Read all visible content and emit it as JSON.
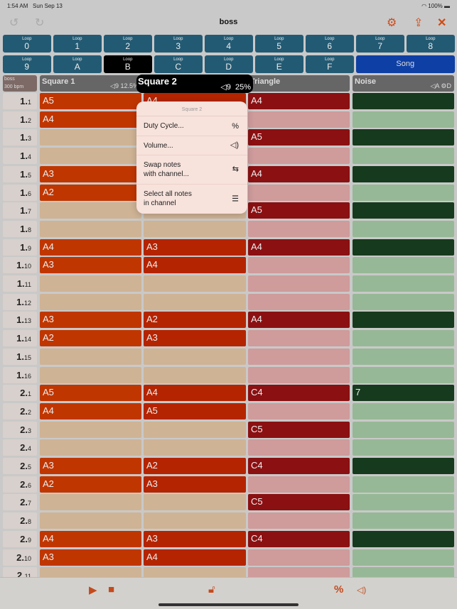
{
  "status": {
    "time": "1:54 AM",
    "date": "Sun Sep 13",
    "battery": "100%"
  },
  "header": {
    "title": "boss",
    "icons": [
      "undo-icon",
      "redo-icon",
      "settings-gear-icon",
      "share-icon",
      "close-icon"
    ],
    "accent": "#d04a14"
  },
  "loops": {
    "small": "Loop",
    "labels": [
      "0",
      "1",
      "2",
      "3",
      "4",
      "5",
      "6",
      "7",
      "8",
      "9",
      "A",
      "B",
      "C",
      "D",
      "E",
      "F"
    ],
    "selected": "B",
    "song": "Song"
  },
  "song_info": {
    "name": "boss",
    "tempo": "300 bpm"
  },
  "channels": [
    {
      "name": "Square 1",
      "volume": "9",
      "extra": "12.5%"
    },
    {
      "name": "Square 2",
      "volume": "9",
      "extra": "25%"
    },
    {
      "name": "Triangle",
      "volume": "",
      "extra": ""
    },
    {
      "name": "Noise",
      "volume": "A",
      "extra": "D"
    }
  ],
  "menu": {
    "title": "Square 2",
    "items": [
      {
        "label": "Duty Cycle...",
        "icon": "%"
      },
      {
        "label": "Volume...",
        "icon": "🔈"
      },
      {
        "label": "Swap notes\nwith channel...",
        "icon": "⇆"
      },
      {
        "label": "Select all notes\nin channel",
        "icon": "☰"
      }
    ]
  },
  "rows": [
    {
      "bar": "1.",
      "row": "1",
      "n": [
        "A5",
        "A4",
        "A4",
        ""
      ],
      "f": [
        1,
        1,
        1,
        1
      ]
    },
    {
      "bar": "1.",
      "row": "2",
      "n": [
        "A4",
        "",
        "",
        ""
      ],
      "f": [
        1,
        0,
        0,
        0
      ]
    },
    {
      "bar": "1.",
      "row": "3",
      "n": [
        "",
        "",
        "A5",
        ""
      ],
      "f": [
        0,
        0,
        1,
        1
      ]
    },
    {
      "bar": "1.",
      "row": "4",
      "n": [
        "",
        "",
        "",
        ""
      ],
      "f": [
        0,
        0,
        0,
        0
      ]
    },
    {
      "bar": "1.",
      "row": "5",
      "n": [
        "A3",
        "",
        "A4",
        ""
      ],
      "f": [
        1,
        0,
        1,
        1
      ]
    },
    {
      "bar": "1.",
      "row": "6",
      "n": [
        "A2",
        "",
        "",
        ""
      ],
      "f": [
        1,
        0,
        0,
        0
      ]
    },
    {
      "bar": "1.",
      "row": "7",
      "n": [
        "",
        "",
        "A5",
        ""
      ],
      "f": [
        0,
        0,
        1,
        1
      ]
    },
    {
      "bar": "1.",
      "row": "8",
      "n": [
        "",
        "",
        "",
        ""
      ],
      "f": [
        0,
        0,
        0,
        0
      ]
    },
    {
      "bar": "1.",
      "row": "9",
      "n": [
        "A4",
        "A3",
        "A4",
        ""
      ],
      "f": [
        1,
        1,
        1,
        1
      ]
    },
    {
      "bar": "1.",
      "row": "10",
      "n": [
        "A3",
        "A4",
        "",
        ""
      ],
      "f": [
        1,
        1,
        0,
        0
      ]
    },
    {
      "bar": "1.",
      "row": "11",
      "n": [
        "",
        "",
        "",
        ""
      ],
      "f": [
        0,
        0,
        0,
        0
      ]
    },
    {
      "bar": "1.",
      "row": "12",
      "n": [
        "",
        "",
        "",
        ""
      ],
      "f": [
        0,
        0,
        0,
        0
      ]
    },
    {
      "bar": "1.",
      "row": "13",
      "n": [
        "A3",
        "A2",
        "A4",
        ""
      ],
      "f": [
        1,
        1,
        1,
        1
      ]
    },
    {
      "bar": "1.",
      "row": "14",
      "n": [
        "A2",
        "A3",
        "",
        ""
      ],
      "f": [
        1,
        1,
        0,
        0
      ]
    },
    {
      "bar": "1.",
      "row": "15",
      "n": [
        "",
        "",
        "",
        ""
      ],
      "f": [
        0,
        0,
        0,
        0
      ]
    },
    {
      "bar": "1.",
      "row": "16",
      "n": [
        "",
        "",
        "",
        ""
      ],
      "f": [
        0,
        0,
        0,
        0
      ]
    },
    {
      "bar": "2.",
      "row": "1",
      "n": [
        "A5",
        "A4",
        "C4",
        "7"
      ],
      "f": [
        1,
        1,
        1,
        1
      ]
    },
    {
      "bar": "2.",
      "row": "2",
      "n": [
        "A4",
        "A5",
        "",
        ""
      ],
      "f": [
        1,
        1,
        0,
        0
      ]
    },
    {
      "bar": "2.",
      "row": "3",
      "n": [
        "",
        "",
        "C5",
        ""
      ],
      "f": [
        0,
        0,
        1,
        0
      ]
    },
    {
      "bar": "2.",
      "row": "4",
      "n": [
        "",
        "",
        "",
        ""
      ],
      "f": [
        0,
        0,
        0,
        0
      ]
    },
    {
      "bar": "2.",
      "row": "5",
      "n": [
        "A3",
        "A2",
        "C4",
        ""
      ],
      "f": [
        1,
        1,
        1,
        1
      ]
    },
    {
      "bar": "2.",
      "row": "6",
      "n": [
        "A2",
        "A3",
        "",
        ""
      ],
      "f": [
        1,
        1,
        0,
        0
      ]
    },
    {
      "bar": "2.",
      "row": "7",
      "n": [
        "",
        "",
        "C5",
        ""
      ],
      "f": [
        0,
        0,
        1,
        0
      ]
    },
    {
      "bar": "2.",
      "row": "8",
      "n": [
        "",
        "",
        "",
        ""
      ],
      "f": [
        0,
        0,
        0,
        0
      ]
    },
    {
      "bar": "2.",
      "row": "9",
      "n": [
        "A4",
        "A3",
        "C4",
        ""
      ],
      "f": [
        1,
        1,
        1,
        1
      ]
    },
    {
      "bar": "2.",
      "row": "10",
      "n": [
        "A3",
        "A4",
        "",
        ""
      ],
      "f": [
        1,
        1,
        0,
        0
      ]
    },
    {
      "bar": "2.",
      "row": "11",
      "n": [
        "",
        "",
        "",
        ""
      ],
      "f": [
        0,
        0,
        0,
        0
      ]
    }
  ],
  "toolbar": {
    "icons": [
      "play-icon",
      "stop-icon",
      "unlock-icon",
      "duty-percent-icon",
      "volume-icon"
    ],
    "percent": "%"
  }
}
